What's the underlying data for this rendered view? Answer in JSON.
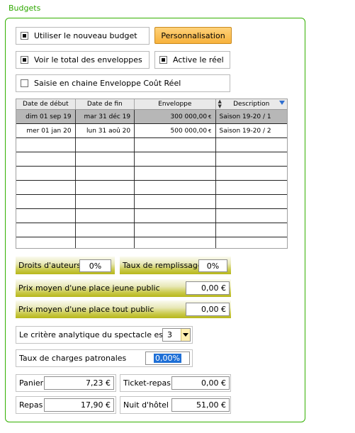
{
  "group": {
    "title": "Budgets"
  },
  "options": {
    "use_new_budget": {
      "label": "Utiliser le nouveau budget",
      "checked": true
    },
    "personnalisation_button": "Personnalisation",
    "show_total": {
      "label": "Voir le total des enveloppes",
      "checked": true
    },
    "active_real": {
      "label": "Active le réel",
      "checked": true
    },
    "chain_entry": {
      "label": "Saisie en chaine Enveloppe Coût Réel",
      "checked": false
    }
  },
  "table": {
    "headers": [
      "Date de début",
      "Date de fin",
      "Enveloppe",
      "Description"
    ],
    "rows": [
      {
        "start": "dim 01 sep 19",
        "end": "mar 31 déc 19",
        "amount": "300 000,00",
        "currency": "€",
        "description": "Saison 19-20 / 1"
      },
      {
        "start": "mer 01 jan 20",
        "end": "lun 31 aoû 20",
        "amount": "500 000,00",
        "currency": "€",
        "description": "Saison 19-20 / 2"
      }
    ]
  },
  "rates": {
    "author_rights": {
      "label": "Droits d'auteurs",
      "value": "0%"
    },
    "fill_rate": {
      "label": "Taux de remplissage",
      "value": "0%"
    },
    "avg_price_young": {
      "label": "Prix moyen d'une place jeune public",
      "value": "0,00 €"
    },
    "avg_price_all": {
      "label": "Prix moyen d'une place tout public",
      "value": "0,00 €"
    }
  },
  "analytic": {
    "label": "Le critère analytique du spectacle est le",
    "value": "3"
  },
  "employer_charges": {
    "label": "Taux de charges patronales",
    "value": "0,00%"
  },
  "expenses": {
    "panier": {
      "label": "Panier",
      "value": "7,23 €"
    },
    "ticket_repas": {
      "label": "Ticket-repas",
      "value": "0,00 €"
    },
    "repas": {
      "label": "Repas",
      "value": "17,90 €"
    },
    "nuit_hotel": {
      "label": "Nuit d'hôtel",
      "value": "51,00 €"
    }
  },
  "colors": {
    "group_border": "#33b000",
    "button": "#f7b23c",
    "selection": "#1e6fd6",
    "header_accent": "#b6b61a"
  }
}
